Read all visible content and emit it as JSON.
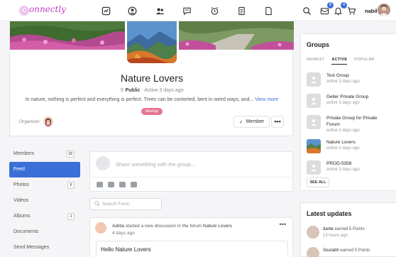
{
  "topbar": {
    "logo_letter": "c",
    "logo_text": "onnectly",
    "username": "nabil",
    "nav_icons": [
      "activity-icon",
      "profile-icon",
      "members-icon",
      "chat-icon",
      "alarm-icon",
      "document-icon",
      "page-icon"
    ],
    "messages_count": "6",
    "notifications_count": "4"
  },
  "group": {
    "title": "Nature Lovers",
    "visibility": "Public",
    "activity": "· Active 3 days ago",
    "description": "In nature, nothing is perfect and everything is perfect. Trees can be contorted, bent in weird ways, and...",
    "view_more": "View more",
    "organizer_label": "Organizer:",
    "type_badge": "Meetup",
    "member_button": "Member",
    "more_button": "•••"
  },
  "leftnav": {
    "items": [
      {
        "label": "Members",
        "count": "18"
      },
      {
        "label": "Feed",
        "count": ""
      },
      {
        "label": "Photos",
        "count": "6"
      },
      {
        "label": "Videos",
        "count": ""
      },
      {
        "label": "Albums",
        "count": "1"
      },
      {
        "label": "Documents",
        "count": ""
      },
      {
        "label": "Send Messages",
        "count": ""
      }
    ],
    "active": "Feed"
  },
  "composer": {
    "placeholder": "Share something with the group..."
  },
  "search_feed": {
    "placeholder": "Search Feed..."
  },
  "activity": {
    "user": "Adrita",
    "action": " started a new discussion in the forum ",
    "forum": "Nature Lovers",
    "time": "4 days ago",
    "dots": "•••",
    "title": "Hello Nature Lovers"
  },
  "groups_widget": {
    "title": "Groups",
    "tabs": [
      "NEWEST",
      "ACTIVE",
      "POPULAR"
    ],
    "active_tab": "ACTIVE",
    "items": [
      {
        "name": "Test Group",
        "active": "active 3 days ago"
      },
      {
        "name": "Geller Private Group",
        "active": "active 3 days ago"
      },
      {
        "name": "Private Group for Private Forum",
        "active": "active 3 days ago"
      },
      {
        "name": "Nature Lovers",
        "active": "active 3 days ago"
      },
      {
        "name": "PROD-5358",
        "active": "active 3 days ago"
      }
    ],
    "see_all": "SEE ALL"
  },
  "updates_widget": {
    "title": "Latest updates",
    "items": [
      {
        "user": "dante",
        "text": " earned 5 Points",
        "time": "13 hours ago"
      },
      {
        "user": "Sourabh",
        "text": " earned 5 Points",
        "time": ""
      }
    ]
  },
  "colors": {
    "accent": "#3b6fd8",
    "logo": "#c43dc7",
    "meetup_badge": "#e4768f"
  }
}
